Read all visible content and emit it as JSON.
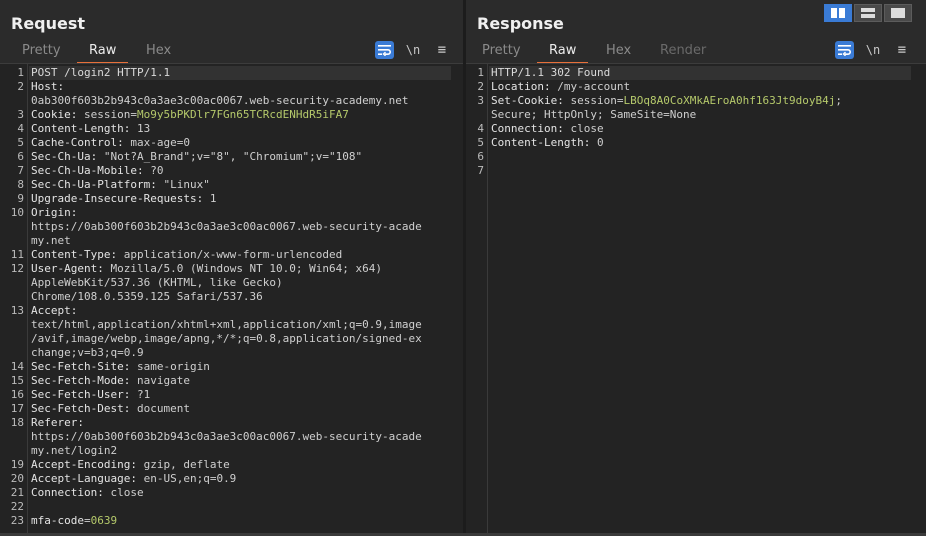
{
  "request": {
    "title": "Request",
    "tabs": [
      "Pretty",
      "Raw",
      "Hex"
    ],
    "active_tab": "Raw",
    "wrap_label": "\\n",
    "menu_label": "≡",
    "lines": [
      {
        "num": "1",
        "rows": [
          [
            {
              "t": "POST /login2 HTTP/1.1",
              "c": "plain"
            }
          ]
        ]
      },
      {
        "num": "2",
        "rows": [
          [
            {
              "t": "Host:",
              "c": "hdr"
            }
          ],
          [
            {
              "t": "0ab300f603b2b943c0a3ae3c00ac0067.web-security-academy.net",
              "c": "val"
            }
          ]
        ]
      },
      {
        "num": "3",
        "rows": [
          [
            {
              "t": "Cookie: ",
              "c": "hdr"
            },
            {
              "t": "session",
              "c": "val"
            },
            {
              "t": "=",
              "c": "val"
            },
            {
              "t": "Mo9y5bPKDlr7FGn65TCRcdENHdR5iFA7",
              "c": "cookie"
            }
          ]
        ]
      },
      {
        "num": "4",
        "rows": [
          [
            {
              "t": "Content-Length: ",
              "c": "hdr"
            },
            {
              "t": "13",
              "c": "val"
            }
          ]
        ]
      },
      {
        "num": "5",
        "rows": [
          [
            {
              "t": "Cache-Control: ",
              "c": "hdr"
            },
            {
              "t": "max-age=0",
              "c": "val"
            }
          ]
        ]
      },
      {
        "num": "6",
        "rows": [
          [
            {
              "t": "Sec-Ch-Ua: ",
              "c": "hdr"
            },
            {
              "t": "\"Not?A_Brand\";v=\"8\", \"Chromium\";v=\"108\"",
              "c": "val"
            }
          ]
        ]
      },
      {
        "num": "7",
        "rows": [
          [
            {
              "t": "Sec-Ch-Ua-Mobile: ",
              "c": "hdr"
            },
            {
              "t": "?0",
              "c": "val"
            }
          ]
        ]
      },
      {
        "num": "8",
        "rows": [
          [
            {
              "t": "Sec-Ch-Ua-Platform: ",
              "c": "hdr"
            },
            {
              "t": "\"Linux\"",
              "c": "val"
            }
          ]
        ]
      },
      {
        "num": "9",
        "rows": [
          [
            {
              "t": "Upgrade-Insecure-Requests: ",
              "c": "hdr"
            },
            {
              "t": "1",
              "c": "val"
            }
          ]
        ]
      },
      {
        "num": "10",
        "rows": [
          [
            {
              "t": "Origin:",
              "c": "hdr"
            }
          ],
          [
            {
              "t": "https://0ab300f603b2b943c0a3ae3c00ac0067.web-security-acade",
              "c": "val"
            }
          ],
          [
            {
              "t": "my.net",
              "c": "val"
            }
          ]
        ]
      },
      {
        "num": "11",
        "rows": [
          [
            {
              "t": "Content-Type: ",
              "c": "hdr"
            },
            {
              "t": "application/x-www-form-urlencoded",
              "c": "val"
            }
          ]
        ]
      },
      {
        "num": "12",
        "rows": [
          [
            {
              "t": "User-Agent: ",
              "c": "hdr"
            },
            {
              "t": "Mozilla/5.0 (Windows NT 10.0; Win64; x64)",
              "c": "val"
            }
          ],
          [
            {
              "t": "AppleWebKit/537.36 (KHTML, like Gecko)",
              "c": "val"
            }
          ],
          [
            {
              "t": "Chrome/108.0.5359.125 Safari/537.36",
              "c": "val"
            }
          ]
        ]
      },
      {
        "num": "13",
        "rows": [
          [
            {
              "t": "Accept:",
              "c": "hdr"
            }
          ],
          [
            {
              "t": "text/html,application/xhtml+xml,application/xml;q=0.9,image",
              "c": "val"
            }
          ],
          [
            {
              "t": "/avif,image/webp,image/apng,*/*;q=0.8,application/signed-ex",
              "c": "val"
            }
          ],
          [
            {
              "t": "change;v=b3;q=0.9",
              "c": "val"
            }
          ]
        ]
      },
      {
        "num": "14",
        "rows": [
          [
            {
              "t": "Sec-Fetch-Site: ",
              "c": "hdr"
            },
            {
              "t": "same-origin",
              "c": "val"
            }
          ]
        ]
      },
      {
        "num": "15",
        "rows": [
          [
            {
              "t": "Sec-Fetch-Mode: ",
              "c": "hdr"
            },
            {
              "t": "navigate",
              "c": "val"
            }
          ]
        ]
      },
      {
        "num": "16",
        "rows": [
          [
            {
              "t": "Sec-Fetch-User: ",
              "c": "hdr"
            },
            {
              "t": "?1",
              "c": "val"
            }
          ]
        ]
      },
      {
        "num": "17",
        "rows": [
          [
            {
              "t": "Sec-Fetch-Dest: ",
              "c": "hdr"
            },
            {
              "t": "document",
              "c": "val"
            }
          ]
        ]
      },
      {
        "num": "18",
        "rows": [
          [
            {
              "t": "Referer:",
              "c": "hdr"
            }
          ],
          [
            {
              "t": "https://0ab300f603b2b943c0a3ae3c00ac0067.web-security-acade",
              "c": "val"
            }
          ],
          [
            {
              "t": "my.net/login2",
              "c": "val"
            }
          ]
        ]
      },
      {
        "num": "19",
        "rows": [
          [
            {
              "t": "Accept-Encoding: ",
              "c": "hdr"
            },
            {
              "t": "gzip, deflate",
              "c": "val"
            }
          ]
        ]
      },
      {
        "num": "20",
        "rows": [
          [
            {
              "t": "Accept-Language: ",
              "c": "hdr"
            },
            {
              "t": "en-US,en;q=0.9",
              "c": "val"
            }
          ]
        ]
      },
      {
        "num": "21",
        "rows": [
          [
            {
              "t": "Connection: ",
              "c": "hdr"
            },
            {
              "t": "close",
              "c": "val"
            }
          ]
        ]
      },
      {
        "num": "22",
        "rows": [
          [
            {
              "t": "",
              "c": "val"
            }
          ]
        ]
      },
      {
        "num": "23",
        "rows": [
          [
            {
              "t": "mfa-code",
              "c": "hdr"
            },
            {
              "t": "=",
              "c": "val"
            },
            {
              "t": "0639",
              "c": "cookie"
            }
          ]
        ]
      }
    ]
  },
  "response": {
    "title": "Response",
    "tabs": [
      "Pretty",
      "Raw",
      "Hex",
      "Render"
    ],
    "active_tab": "Raw",
    "wrap_label": "\\n",
    "menu_label": "≡",
    "lines": [
      {
        "num": "1",
        "rows": [
          [
            {
              "t": "HTTP/1.1 302 Found",
              "c": "plain"
            }
          ]
        ]
      },
      {
        "num": "2",
        "rows": [
          [
            {
              "t": "Location: ",
              "c": "hdr"
            },
            {
              "t": "/my-account",
              "c": "val"
            }
          ]
        ]
      },
      {
        "num": "3",
        "rows": [
          [
            {
              "t": "Set-Cookie: ",
              "c": "hdr"
            },
            {
              "t": "session",
              "c": "val"
            },
            {
              "t": "=",
              "c": "val"
            },
            {
              "t": "LBOq8A0CoXMkAEroA0hf163Jt9doyB4j",
              "c": "cookie"
            },
            {
              "t": ";",
              "c": "val"
            }
          ],
          [
            {
              "t": "Secure; HttpOnly; SameSite=None",
              "c": "val"
            }
          ]
        ]
      },
      {
        "num": "4",
        "rows": [
          [
            {
              "t": "Connection: ",
              "c": "hdr"
            },
            {
              "t": "close",
              "c": "val"
            }
          ]
        ]
      },
      {
        "num": "5",
        "rows": [
          [
            {
              "t": "Content-Length: ",
              "c": "hdr"
            },
            {
              "t": "0",
              "c": "val"
            }
          ]
        ]
      },
      {
        "num": "6",
        "rows": [
          [
            {
              "t": "",
              "c": "val"
            }
          ]
        ]
      },
      {
        "num": "7",
        "rows": [
          [
            {
              "t": "",
              "c": "val"
            }
          ]
        ]
      }
    ]
  },
  "view_layout": {
    "options": [
      "side-by-side-icon",
      "top-bottom-icon",
      "single-pane-icon"
    ],
    "active": "side-by-side-icon"
  },
  "colors": {
    "accent": "#e8703a",
    "button_blue": "#3a7bd5",
    "cookie_value": "#b5c96b"
  }
}
